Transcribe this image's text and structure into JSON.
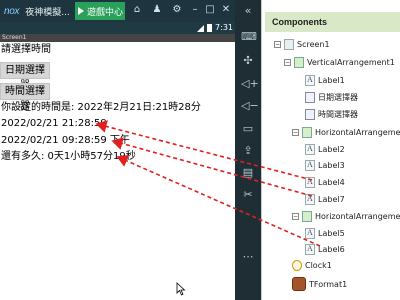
{
  "emulator": {
    "logo": "nox",
    "title": "夜神模擬...",
    "game_center": "遊戲中心",
    "status_time": "7:31",
    "screen_title": "Screen1"
  },
  "app": {
    "prompt": "請選擇時間",
    "date_picker_label": "日期選擇器",
    "time_picker_label": "時間選擇器",
    "set_time_text": "你設定的時間是: 2022年2月21日:21時28分",
    "label4_text": "2022/02/21 21:28:59",
    "label7_text": "2022/02/21 09:28:59 下午",
    "remaining_text": "還有多久: 0天1小時57分19秒"
  },
  "components": {
    "header": "Components",
    "tree": [
      {
        "name": "Screen1",
        "type": "screen",
        "toggle": "−"
      },
      {
        "name": "VerticalArrangement1",
        "type": "arr",
        "toggle": "−"
      },
      {
        "name": "Label1",
        "type": "label"
      },
      {
        "name": "日期選擇器",
        "type": "picker"
      },
      {
        "name": "時間選擇器",
        "type": "picker"
      },
      {
        "name": "HorizontalArrangemen",
        "type": "arr",
        "toggle": "−"
      },
      {
        "name": "Label2",
        "type": "label"
      },
      {
        "name": "Label3",
        "type": "label"
      },
      {
        "name": "Label4",
        "type": "label"
      },
      {
        "name": "Label7",
        "type": "label"
      },
      {
        "name": "HorizontalArrangemen",
        "type": "arr",
        "toggle": "−"
      },
      {
        "name": "Label5",
        "type": "label"
      },
      {
        "name": "Label6",
        "type": "label"
      },
      {
        "name": "Clock1",
        "type": "clock"
      },
      {
        "name": "TFormat1",
        "type": "tfmt"
      }
    ]
  },
  "colors": {
    "arrow": "#e02020",
    "header_bg": "#d9e8c7",
    "game_center_bg": "#2aa15a"
  }
}
